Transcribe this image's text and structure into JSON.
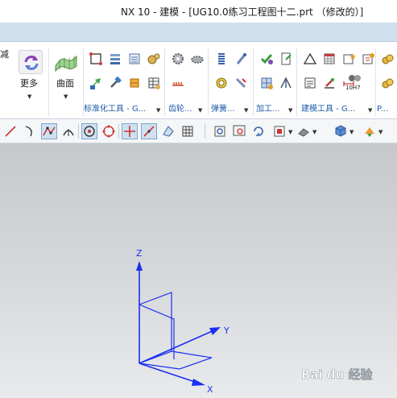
{
  "window": {
    "title": "NX 10 - 建模 - [UG10.0练习工程图十二.prt （修改的）]"
  },
  "ribbon": {
    "left_partial_label": "减",
    "more_label": "更多",
    "surface_label": "曲面",
    "groups": [
      {
        "label": "标准化工具 - G..."
      },
      {
        "label": "齿轮..."
      },
      {
        "label": "弹簧..."
      },
      {
        "label": "加工..."
      },
      {
        "label": "建模工具 - G..."
      },
      {
        "label": "P..."
      }
    ],
    "tolerance_label": "10H7"
  },
  "csys": {
    "x_label": "X",
    "y_label": "Y",
    "z_label": "Z"
  },
  "colors": {
    "axis": "#1a2ff0",
    "ribbon_label": "#1c5aa8",
    "tabstrip": "#cfe0ee"
  },
  "watermark": {
    "text": "Bai du 经验"
  }
}
